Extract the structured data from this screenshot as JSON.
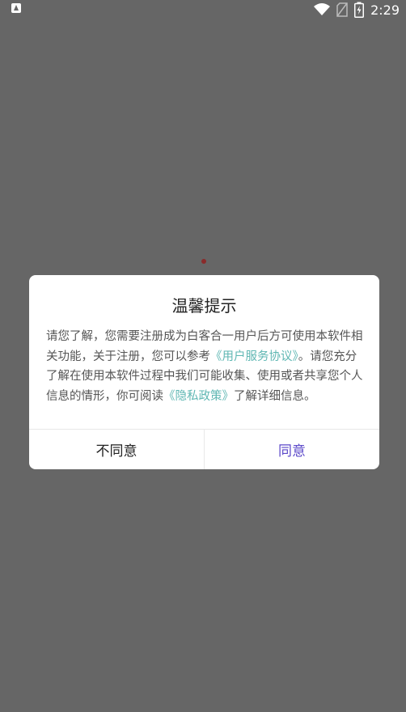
{
  "status_bar": {
    "time": "2:29",
    "icons": [
      "app-notification-icon",
      "wifi-icon",
      "no-sim-icon",
      "battery-charging-icon"
    ]
  },
  "dialog": {
    "title": "温馨提示",
    "body": {
      "part1": "请您了解，您需要注册成为白客合一用户后方可使用本软件相关功能，关于注册，您可以参考",
      "link_user_agreement": "《用户服务协议》",
      "part2": "。请您充分了解在使用本软件过程中我们可能收集、使用或者共享您个人信息的情形，你可阅读",
      "link_privacy_policy": "《隐私政策》",
      "part3": "了解详细信息。"
    },
    "buttons": {
      "disagree": "不同意",
      "agree": "同意"
    }
  },
  "colors": {
    "overlay": "#666666",
    "link": "#5fb7b3",
    "agree": "#5b48c9"
  }
}
